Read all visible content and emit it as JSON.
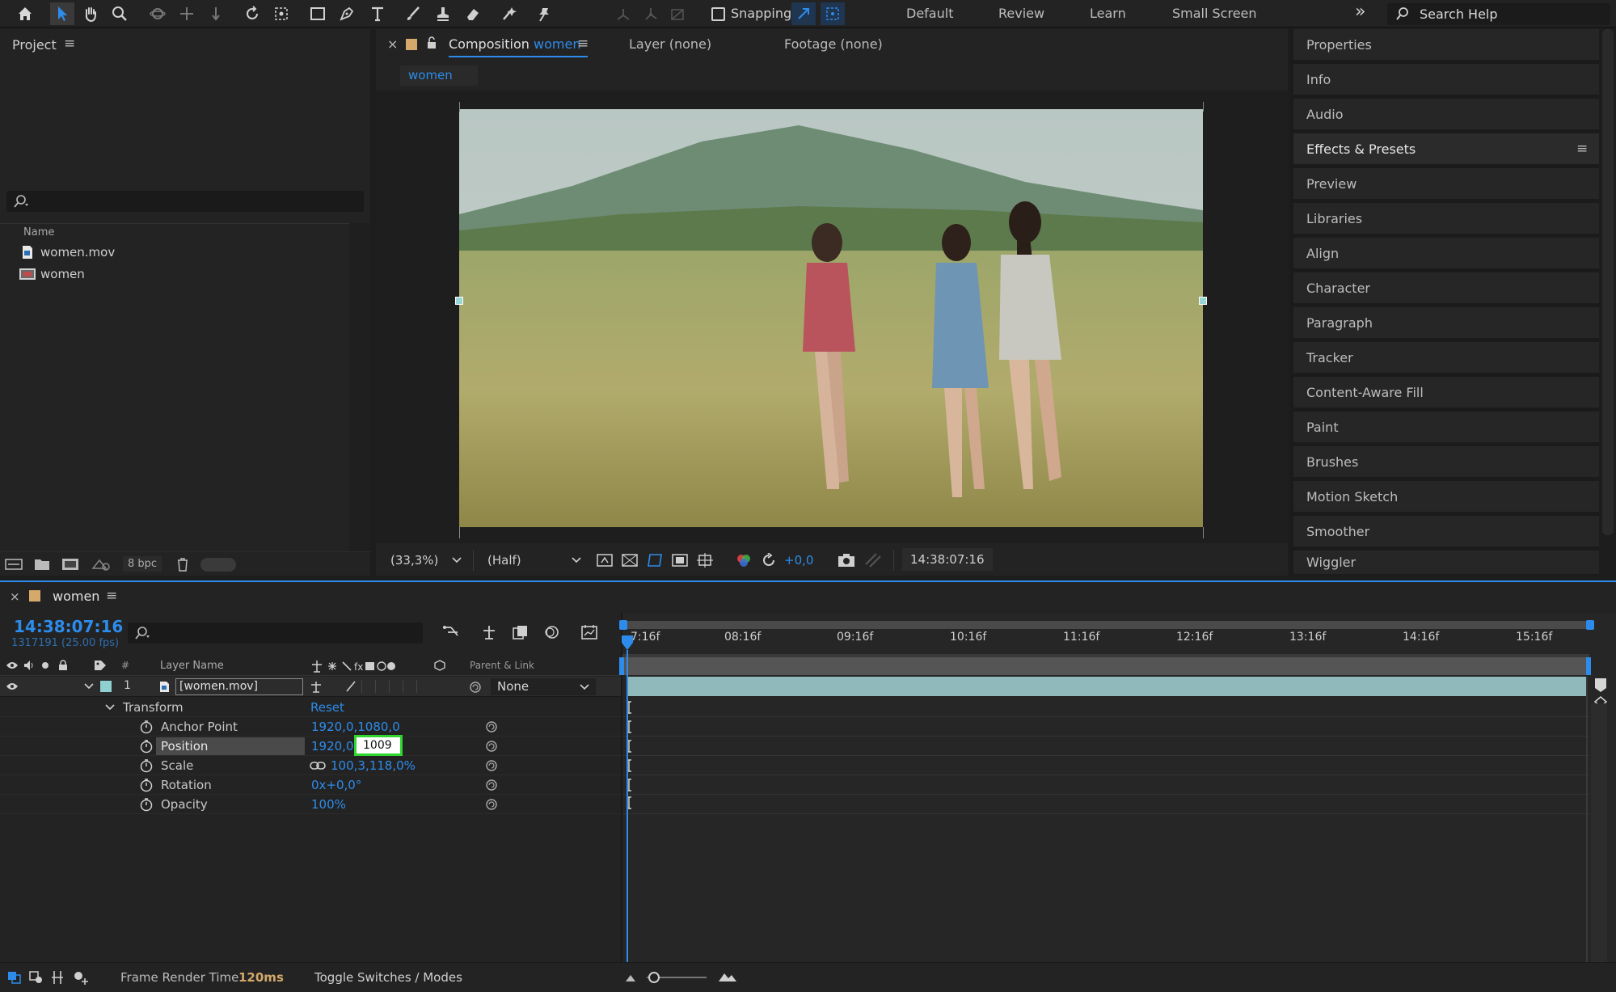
{
  "toolbar": {
    "snapping_label": "Snapping",
    "workspaces": [
      "Default",
      "Review",
      "Learn",
      "Small Screen"
    ],
    "overflow_glyph": "»",
    "search_placeholder": "Search Help"
  },
  "project": {
    "title": "Project",
    "menu_glyph": "≡",
    "column_name": "Name",
    "items": [
      {
        "label": "women.mov",
        "icon": "footage-icon"
      },
      {
        "label": "women",
        "icon": "composition-icon"
      }
    ],
    "bpc_label": "8 bpc"
  },
  "comp_viewer": {
    "close_glyph": "×",
    "tab_prefix": "Composition",
    "tab_name": "women",
    "menu_glyph": "≡",
    "layer_tab": "Layer (none)",
    "footage_tab": "Footage (none)",
    "breadcrumb": "women",
    "zoom": "(33,3%)",
    "resolution": "(Half)",
    "exposure": "+0,0",
    "timecode": "14:38:07:16"
  },
  "right_panel": {
    "items": [
      "Properties",
      "Info",
      "Audio",
      "Effects & Presets",
      "Preview",
      "Libraries",
      "Align",
      "Character",
      "Paragraph",
      "Tracker",
      "Content-Aware Fill",
      "Paint",
      "Brushes",
      "Motion Sketch",
      "Smoother",
      "Wiggler"
    ],
    "active_item": "Effects & Presets",
    "menu_glyph": "≡"
  },
  "timeline": {
    "close_glyph": "×",
    "comp_name": "women",
    "menu_glyph": "≡",
    "timecode": "14:38:07:16",
    "frame_info": "1317191 (25.00 fps)",
    "col_hash": "#",
    "col_layer_name": "Layer Name",
    "col_parent": "Parent & Link",
    "layer": {
      "number": "1",
      "name": "[women.mov]",
      "parent": "None",
      "color": "#8fd1d0"
    },
    "transform_label": "Transform",
    "reset_label": "Reset",
    "properties": [
      {
        "label": "Anchor Point",
        "value": "1920,0,1080,0"
      },
      {
        "label": "Position",
        "value": "1920,0,",
        "editing_value": "1009"
      },
      {
        "label": "Scale",
        "value": "100,3,118,0%"
      },
      {
        "label": "Rotation",
        "value": "0x+0,0°"
      },
      {
        "label": "Opacity",
        "value": "100%"
      }
    ],
    "ruler_labels": [
      "7:16f",
      "08:16f",
      "09:16f",
      "10:16f",
      "11:16f",
      "12:16f",
      "13:16f",
      "14:16f",
      "15:16f"
    ],
    "footer_render_label": "Frame Render Time",
    "footer_render_value": "120ms",
    "footer_toggle": "Toggle Switches / Modes"
  },
  "colors": {
    "accent_blue": "#2d8ceb",
    "edit_highlight": "#2ed62e",
    "layer_bar": "#8fb9ba"
  }
}
